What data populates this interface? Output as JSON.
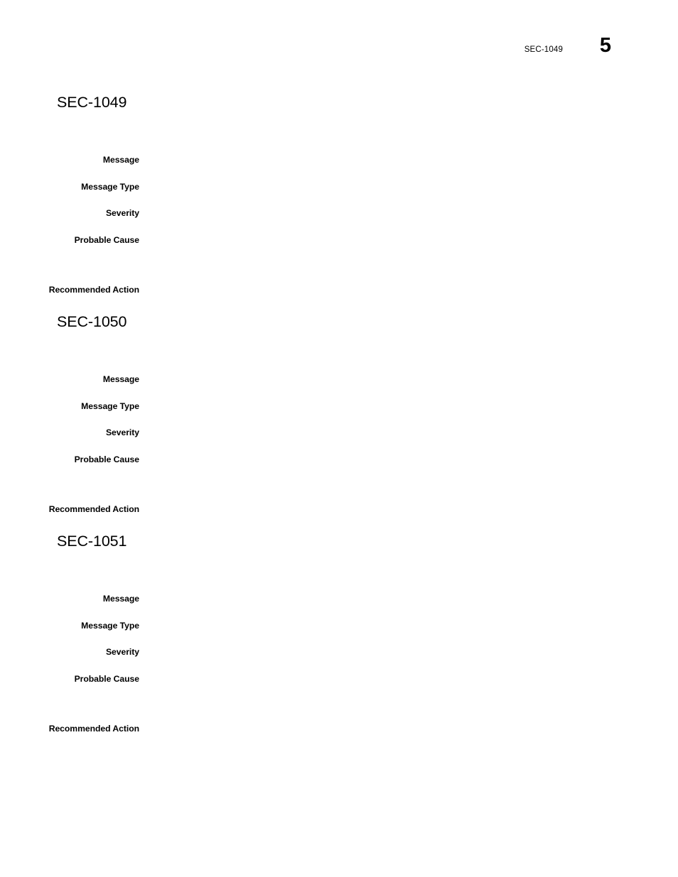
{
  "page": {
    "header": {
      "doc_id": "SEC-1049",
      "page_number": "5"
    },
    "background_color": "#ffffff",
    "text_color": "#000000"
  },
  "sections": [
    {
      "heading": "SEC-1049",
      "fields": [
        {
          "label": "Message",
          "value": ""
        },
        {
          "label": "Message Type",
          "value": ""
        },
        {
          "label": "Severity",
          "value": ""
        },
        {
          "label": "Probable Cause",
          "value": ""
        },
        {
          "label": "Recommended Action",
          "value": ""
        }
      ]
    },
    {
      "heading": "SEC-1050",
      "fields": [
        {
          "label": "Message",
          "value": ""
        },
        {
          "label": "Message Type",
          "value": ""
        },
        {
          "label": "Severity",
          "value": ""
        },
        {
          "label": "Probable Cause",
          "value": ""
        },
        {
          "label": "Recommended Action",
          "value": ""
        }
      ]
    },
    {
      "heading": "SEC-1051",
      "fields": [
        {
          "label": "Message",
          "value": ""
        },
        {
          "label": "Message Type",
          "value": ""
        },
        {
          "label": "Severity",
          "value": ""
        },
        {
          "label": "Probable Cause",
          "value": ""
        },
        {
          "label": "Recommended Action",
          "value": ""
        }
      ]
    }
  ],
  "layout": {
    "section_tops": [
      133,
      442,
      751
    ],
    "field_tops": [
      50,
      88,
      125,
      163,
      233
    ],
    "label_right_edge": 196
  }
}
